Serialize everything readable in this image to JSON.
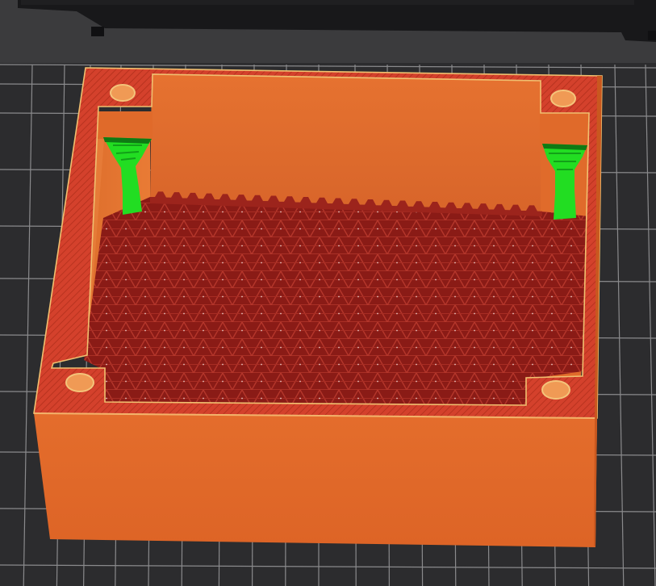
{
  "viewport": {
    "view_mode": "sliced-preview",
    "colors": {
      "background": "#3b3b3d",
      "bed_surface": "#2c2c2e",
      "bed_grid_line": "#8a8a8c",
      "printer_frame": "#141416",
      "wall_orange": "#e06a2a",
      "wall_shadow": "#c9581f",
      "top_rim": "#d4412c",
      "rim_outline": "#f0c070",
      "infill_base": "#8a1b16",
      "infill_line": "#b5362b",
      "support_green": "#22dd22",
      "support_dark": "#0f7a14"
    }
  }
}
